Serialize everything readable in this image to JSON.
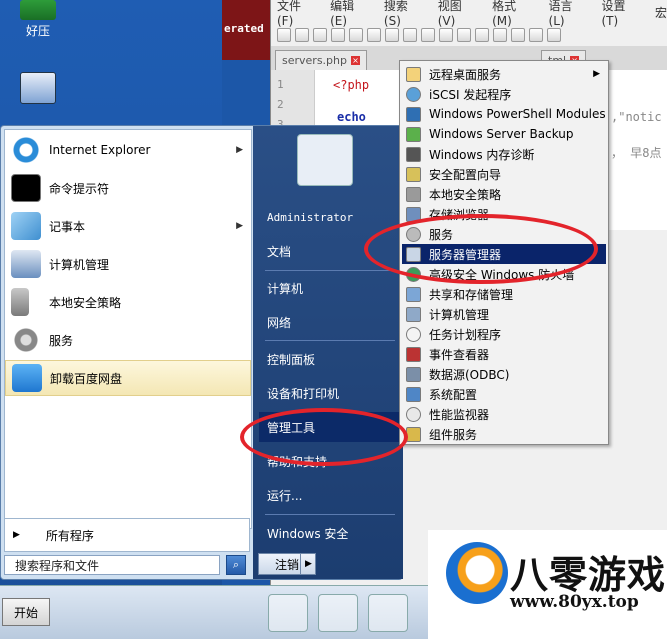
{
  "desktop": {
    "icons": [
      {
        "label": "好压"
      }
    ]
  },
  "console_snippet": "erated",
  "npp": {
    "menu": [
      "文件(F)",
      "编辑(E)",
      "搜索(S)",
      "视图(V)",
      "格式(M)",
      "语言(L)",
      "设置(T)",
      "宏"
    ],
    "tabs": [
      {
        "label": "servers.php"
      },
      {
        "label": "tml"
      }
    ],
    "line_numbers": [
      "1",
      "2",
      "3"
    ],
    "code": {
      "line1": "<?php",
      "line3": "echo",
      "right1": ",\"notic",
      "right2": "，  早8点"
    }
  },
  "start_menu": {
    "left_programs": [
      {
        "label": "Internet Explorer",
        "has_arrow": true
      },
      {
        "label": "命令提示符",
        "has_arrow": false
      },
      {
        "label": "记事本",
        "has_arrow": true
      },
      {
        "label": "计算机管理",
        "has_arrow": false
      },
      {
        "label": "本地安全策略",
        "has_arrow": false
      },
      {
        "label": "服务",
        "has_arrow": false
      },
      {
        "label": "卸载百度网盘",
        "has_arrow": false
      }
    ],
    "all_programs": "所有程序",
    "search_placeholder": "搜索程序和文件",
    "right_items": [
      {
        "label": "Administrator"
      },
      {
        "label": "文档"
      },
      {
        "label": "计算机"
      },
      {
        "label": "网络"
      },
      {
        "label": "控制面板"
      },
      {
        "label": "设备和打印机"
      },
      {
        "label": "管理工具",
        "highlighted": true
      },
      {
        "label": "帮助和支持"
      },
      {
        "label": "运行..."
      },
      {
        "label": "Windows 安全"
      }
    ],
    "logoff": "注销"
  },
  "admin_tools": [
    {
      "label": "远程桌面服务",
      "has_arrow": true
    },
    {
      "label": "iSCSI 发起程序"
    },
    {
      "label": "Windows PowerShell Modules"
    },
    {
      "label": "Windows Server Backup"
    },
    {
      "label": "Windows 内存诊断"
    },
    {
      "label": "安全配置向导"
    },
    {
      "label": "本地安全策略"
    },
    {
      "label": "存储浏览器"
    },
    {
      "label": "服务"
    },
    {
      "label": "服务器管理器",
      "highlighted": true
    },
    {
      "label": "高级安全 Windows 防火墙"
    },
    {
      "label": "共享和存储管理"
    },
    {
      "label": "计算机管理"
    },
    {
      "label": "任务计划程序"
    },
    {
      "label": "事件查看器"
    },
    {
      "label": "数据源(ODBC)"
    },
    {
      "label": "系统配置"
    },
    {
      "label": "性能监视器"
    },
    {
      "label": "组件服务"
    }
  ],
  "taskbar": {
    "start_label": "开始"
  },
  "watermark": {
    "title": "八零游戏",
    "url": "www.80yx.top"
  },
  "colors": {
    "highlight": "#0a246a",
    "annotation_ring": "#e3242b",
    "start_right_pane": "#1c3d70"
  }
}
